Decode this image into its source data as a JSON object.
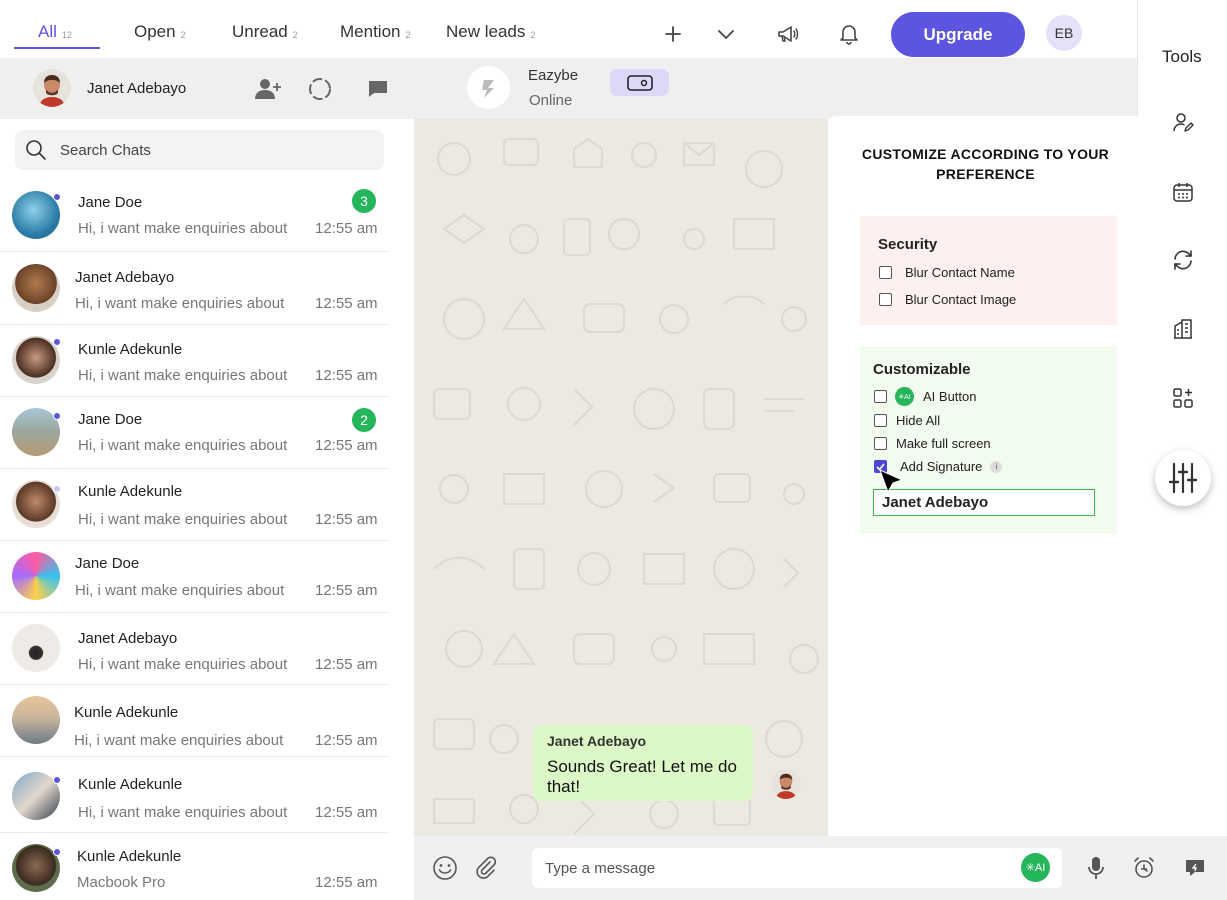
{
  "tabs": [
    {
      "label": "All",
      "count": "12"
    },
    {
      "label": "Open",
      "count": "2"
    },
    {
      "label": "Unread",
      "count": "2"
    },
    {
      "label": "Mention",
      "count": "2"
    },
    {
      "label": "New leads",
      "count": "2"
    }
  ],
  "header": {
    "upgrade_label": "Upgrade",
    "user_initials": "EB"
  },
  "tools": {
    "title": "Tools"
  },
  "subheader": {
    "agent_name": "Janet Adebayo",
    "contact_name": "Eazybe",
    "contact_status": "Online"
  },
  "search": {
    "placeholder": "Search Chats"
  },
  "chats": [
    {
      "name": "Jane Doe",
      "preview": "Hi, i want make enquiries about",
      "time": "12:55 am",
      "badge": "3"
    },
    {
      "name": "Janet Adebayo",
      "preview": "Hi, i want make enquiries about",
      "time": "12:55 am"
    },
    {
      "name": "Kunle Adekunle",
      "preview": "Hi, i want make enquiries about",
      "time": "12:55 am"
    },
    {
      "name": "Jane Doe",
      "preview": "Hi, i want make enquiries about",
      "time": "12:55 am",
      "badge": "2"
    },
    {
      "name": "Kunle Adekunle",
      "preview": "Hi, i want make enquiries about",
      "time": "12:55 am"
    },
    {
      "name": "Jane Doe",
      "preview": "Hi, i want make enquiries about",
      "time": "12:55 am"
    },
    {
      "name": "Janet Adebayo",
      "preview": "Hi, i want make enquiries about",
      "time": "12:55 am"
    },
    {
      "name": "Kunle Adekunle",
      "preview": "Hi, i want make enquiries about",
      "time": "12:55 am"
    },
    {
      "name": "Kunle Adekunle",
      "preview": "Hi, i want make enquiries about",
      "time": "12:55 am"
    },
    {
      "name": "Kunle Adekunle",
      "preview": "Macbook Pro",
      "time": "12:55 am"
    }
  ],
  "message": {
    "sender": "Janet Adebayo",
    "text": "Sounds Great! Let me do that!"
  },
  "composer": {
    "placeholder": "Type a message",
    "ai_label": "✳AI"
  },
  "panel": {
    "title": "CUSTOMIZE ACCORDING TO YOUR PREFERENCE",
    "security": {
      "heading": "Security",
      "options": [
        {
          "label": "Blur Contact Name",
          "checked": false
        },
        {
          "label": "Blur Contact Image",
          "checked": false
        }
      ]
    },
    "customizable": {
      "heading": "Customizable",
      "ai_icon_label": "✳AI",
      "options": [
        {
          "label": "AI Button",
          "checked": false
        },
        {
          "label": "Hide All",
          "checked": false
        },
        {
          "label": "Make full screen",
          "checked": false
        },
        {
          "label": "Add Signature",
          "checked": true
        }
      ],
      "info_glyph": "i",
      "signature_value": "Janet Adebayo"
    }
  },
  "colors": {
    "accent": "#5b55e0",
    "badge_green": "#25b55a",
    "bubble": "#dcf8c6"
  }
}
